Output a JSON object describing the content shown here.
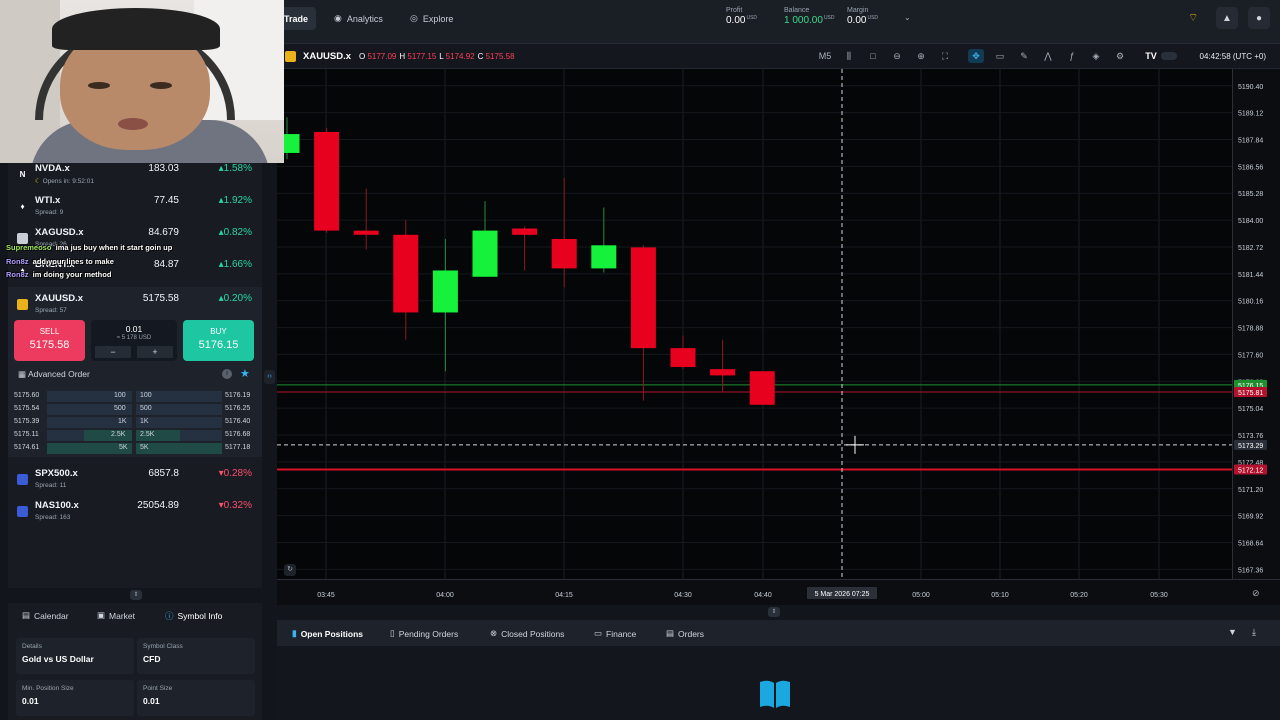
{
  "nav": {
    "tabs": [
      "Trade",
      "Analytics",
      "Explore"
    ]
  },
  "account": {
    "profit_label": "Profit",
    "profit_value": "0.00",
    "profit_unit": "USD",
    "balance_label": "Balance",
    "balance_value": "1 000.00",
    "balance_unit": "USD",
    "margin_label": "Margin",
    "margin_value": "0.00",
    "margin_unit": "USD"
  },
  "watchlist": [
    {
      "symbol": "NVDA.x",
      "sub": "Opens in: 9:52:01",
      "price": "183.03",
      "change": "1.58%",
      "dir": "up",
      "icon": "N"
    },
    {
      "symbol": "WTI.x",
      "sub": "Spread: 9",
      "price": "77.45",
      "change": "1.92%",
      "dir": "up",
      "icon": "oil"
    },
    {
      "symbol": "XAGUSD.x",
      "sub": "Spread: 26",
      "price": "84.679",
      "change": "0.82%",
      "dir": "up",
      "icon": "silver"
    },
    {
      "symbol": "BRENT.x",
      "sub": "",
      "price": "84.87",
      "change": "1.66%",
      "dir": "up",
      "icon": "oil"
    }
  ],
  "selected": {
    "symbol": "XAUUSD.x",
    "sub": "Spread: 57",
    "price": "5175.58",
    "change": "0.20%",
    "sell_label": "SELL",
    "sell_price": "5175.58",
    "buy_label": "BUY",
    "buy_price": "5176.15",
    "qty": "0.01",
    "qty_usd": "≈ 5 178 USD",
    "advanced_label": "Advanced Order"
  },
  "order_book": [
    {
      "bid": "5175.60",
      "bid_vol": "100",
      "ask_vol": "100",
      "ask": "5176.19"
    },
    {
      "bid": "5175.54",
      "bid_vol": "500",
      "ask_vol": "500",
      "ask": "5176.25"
    },
    {
      "bid": "5175.39",
      "bid_vol": "1K",
      "ask_vol": "1K",
      "ask": "5176.40"
    },
    {
      "bid": "5175.11",
      "bid_vol": "2.5K",
      "ask_vol": "2.5K",
      "ask": "5176.68"
    },
    {
      "bid": "5174.61",
      "bid_vol": "5K",
      "ask_vol": "5K",
      "ask": "5177.18"
    }
  ],
  "watchlist2": [
    {
      "symbol": "SPX500.x",
      "sub": "Spread: 11",
      "price": "6857.8",
      "change": "0.28%",
      "dir": "down"
    },
    {
      "symbol": "NAS100.x",
      "sub": "Spread: 163",
      "price": "25054.89",
      "change": "0.32%",
      "dir": "down"
    }
  ],
  "chat": [
    {
      "user": "Supremeoso",
      "text": "ima jus buy when it start goin up"
    },
    {
      "user": "Ron8z",
      "text": "add your lines to make"
    },
    {
      "user": "Ron8z",
      "text": "im doing your method"
    }
  ],
  "info_tabs": [
    "Calendar",
    "Market",
    "Symbol Info"
  ],
  "symbol_info": {
    "details_label": "Details",
    "details_value": "Gold vs US Dollar",
    "class_label": "Symbol Class",
    "class_value": "CFD",
    "minpos_label": "Min. Position Size",
    "minpos_value": "0.01",
    "point_label": "Point Size",
    "point_value": "0.01"
  },
  "chart_header": {
    "symbol": "XAUUSD.x",
    "o": "5177.09",
    "h": "5177.15",
    "l": "5174.92",
    "c": "5175.58",
    "timeframe": "M5",
    "clock": "04:42:58 (UTC +0)"
  },
  "position_tabs": [
    "Open Positions",
    "Pending Orders",
    "Closed Positions",
    "Finance",
    "Orders"
  ],
  "colors": {
    "bull": "#16f23c",
    "bear": "#e8001f",
    "accent": "#39b4f2"
  },
  "chart_data": {
    "type": "candlestick",
    "x_ticks": [
      "03:45",
      "04:00",
      "04:15",
      "04:30",
      "04:40",
      "05:00",
      "05:10",
      "05:20",
      "05:30"
    ],
    "y_ticks": [
      5190.4,
      5189.12,
      5187.84,
      5186.56,
      5185.28,
      5184.0,
      5182.72,
      5181.44,
      5180.16,
      5178.88,
      5177.6,
      5176.32,
      5175.04,
      5173.76,
      5172.48,
      5171.2,
      5169.92,
      5168.64,
      5167.36
    ],
    "ylim": [
      5166.9,
      5191.2
    ],
    "candles": [
      {
        "o": 5187.2,
        "c": 5188.1,
        "h": 5188.9,
        "l": 5186.9
      },
      {
        "o": 5188.2,
        "c": 5183.5,
        "h": 5188.4,
        "l": 5183.4
      },
      {
        "o": 5183.5,
        "c": 5183.3,
        "h": 5185.5,
        "l": 5182.6
      },
      {
        "o": 5183.3,
        "c": 5179.6,
        "h": 5184.0,
        "l": 5178.3
      },
      {
        "o": 5179.6,
        "c": 5181.6,
        "h": 5183.1,
        "l": 5176.8
      },
      {
        "o": 5181.3,
        "c": 5183.5,
        "h": 5184.9,
        "l": 5181.3
      },
      {
        "o": 5183.6,
        "c": 5183.3,
        "h": 5183.7,
        "l": 5181.6
      },
      {
        "o": 5183.1,
        "c": 5181.7,
        "h": 5186.0,
        "l": 5180.8
      },
      {
        "o": 5181.7,
        "c": 5182.8,
        "h": 5184.6,
        "l": 5181.5
      },
      {
        "o": 5182.7,
        "c": 5177.9,
        "h": 5182.8,
        "l": 5175.4
      },
      {
        "o": 5177.9,
        "c": 5177.0,
        "h": 5178.5,
        "l": 5176.9
      },
      {
        "o": 5176.9,
        "c": 5176.6,
        "h": 5178.3,
        "l": 5175.8
      },
      {
        "o": 5176.8,
        "c": 5175.2,
        "h": 5176.8,
        "l": 5175.2
      }
    ],
    "price_labels": [
      {
        "price": 5176.15,
        "text": "5176.15",
        "color": "#1f8f2f"
      },
      {
        "price": 5175.81,
        "text": "5175.81",
        "color": "#b3122e"
      },
      {
        "price": 5173.29,
        "text": "5173.29",
        "color": "#2a2f38"
      },
      {
        "price": 5172.12,
        "text": "5172.12",
        "color": "#b3122e"
      }
    ],
    "crosshair_time": "5 Mar 2026 07:25"
  }
}
